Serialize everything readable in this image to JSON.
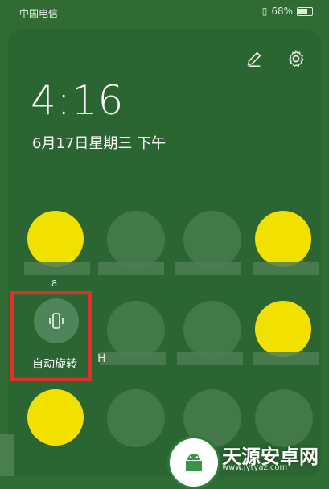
{
  "status_bar": {
    "carrier": "中国电信",
    "battery": "68%"
  },
  "clock": {
    "time": "4:16",
    "date": "6月17日星期三 下午"
  },
  "tile_labels": {
    "auto_rotate": "自动旋转",
    "small_number": "8",
    "partial_h": "H"
  },
  "watermark": {
    "name": "天源安卓网",
    "url": "www.jytyaz.com"
  },
  "icons": {
    "edit": "pencil-icon",
    "settings": "gear-icon",
    "rotate": "phone-rotate-icon"
  }
}
